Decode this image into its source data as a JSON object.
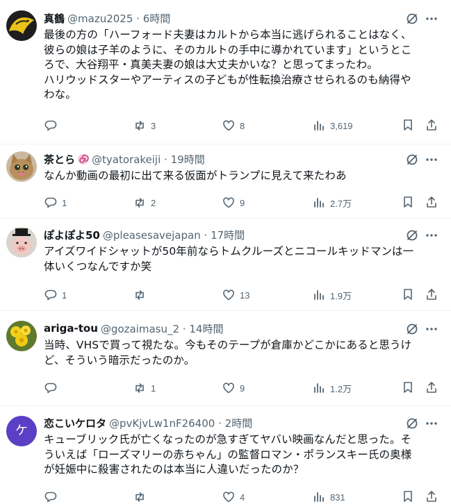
{
  "posts": [
    {
      "display_name": "真鶴",
      "handle": "@mazu2025",
      "separator": "·",
      "time": "6時間",
      "avatar": "yellow-bird-avatar",
      "text": "最後の方の「ハーフォード夫妻はカルトから本当に逃げられることはなく、\n彼らの娘は子羊のように、そのカルトの手中に導かれています」というとこ\nろで、大谷翔平・真美夫妻の娘は大丈夫かいな？と思ってまったわ。\nハリウッドスターやアーティスの子どもが性転換治療させられるのも納得や\nわな。",
      "replies": "",
      "reposts": "3",
      "likes": "8",
      "views": "3,619"
    },
    {
      "display_name": "茶とら",
      "badge": "swirl-emoji",
      "handle": "@tyatorakeiji",
      "separator": "·",
      "time": "19時間",
      "avatar": "cat-avatar",
      "text": "なんか動画の最初に出て来る仮面がトランプに見えて来たわあ",
      "replies": "1",
      "reposts": "2",
      "likes": "9",
      "views": "2.7万"
    },
    {
      "display_name": "ぽよぽよ50",
      "handle": "@pleasesavejapan",
      "separator": "·",
      "time": "17時間",
      "avatar": "pig-with-hat-avatar",
      "text": "アイズワイドシャットが50年前ならトムクルーズとニコールキッドマンは一\n体いくつなんですか笑",
      "replies": "1",
      "reposts": "",
      "likes": "13",
      "views": "1.9万"
    },
    {
      "display_name": "ariga-tou",
      "handle": "@gozaimasu_2",
      "separator": "·",
      "time": "14時間",
      "avatar": "yellow-flowers-avatar",
      "text": "当時、VHSで買って視たな。今もそのテープが倉庫かどこかにあると思うけ\nど、そういう暗示だったのか。",
      "replies": "",
      "reposts": "1",
      "likes": "9",
      "views": "1.2万"
    },
    {
      "display_name": "恋こいケロタ",
      "handle": "@pvKjvLw1nF26400",
      "separator": "·",
      "time": "2時間",
      "avatar": "letter-avatar",
      "avatar_letter": "ケ",
      "text": "キューブリック氏が亡くなったのが急すぎてヤバい映画なんだと思った。そ\nういえば「ローズマリーの赤ちゃん」の監督ロマン・ポランスキー氏の奥様\nが妊娠中に殺害されたのは本当に人違いだったのか？",
      "replies": "",
      "reposts": "",
      "likes": "4",
      "views": "831"
    }
  ],
  "icons": {
    "reply": "reply-icon",
    "repost": "repost-icon",
    "like": "like-icon",
    "views": "views-icon",
    "bookmark": "bookmark-icon",
    "share": "share-icon",
    "grok": "grok-icon",
    "more": "more-icon"
  },
  "colors": {
    "text": "#0f1419",
    "secondary": "#536471",
    "divider": "#eff3f4",
    "letter_avatar_bg": "#5b3fc4"
  }
}
